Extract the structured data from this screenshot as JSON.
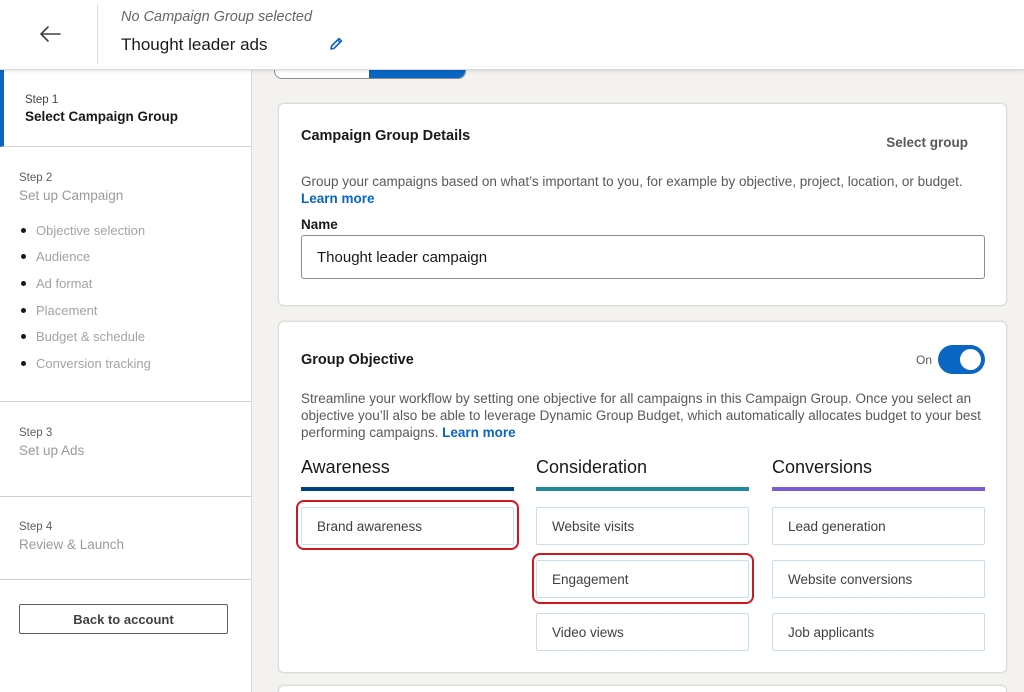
{
  "header": {
    "subtitle": "No Campaign Group selected",
    "title": "Thought leader ads"
  },
  "sidebar": {
    "step1": {
      "label": "Step 1",
      "title": "Select Campaign Group"
    },
    "step2": {
      "label": "Step 2",
      "title": "Set up Campaign",
      "substeps": [
        "Objective selection",
        "Audience",
        "Ad format",
        "Placement",
        "Budget & schedule",
        "Conversion tracking"
      ]
    },
    "step3": {
      "label": "Step 3",
      "title": "Set up Ads"
    },
    "step4": {
      "label": "Step 4",
      "title": "Review & Launch"
    },
    "back_button": "Back to account"
  },
  "details": {
    "title": "Campaign Group Details",
    "select_group": "Select group",
    "description": "Group your campaigns based on what’s important to you, for example by objective, project, location, or budget.",
    "learn_more": "Learn more",
    "name_label": "Name",
    "name_value": "Thought leader campaign"
  },
  "objective": {
    "title": "Group Objective",
    "toggle_label": "On",
    "toggle_on": true,
    "description": "Streamline your workflow by setting one objective for all campaigns in this Campaign Group. Once you select an objective you’ll also be able to leverage Dynamic Group Budget, which automatically allocates budget to your best performing campaigns.",
    "learn_more": "Learn more",
    "columns": [
      {
        "heading": "Awareness",
        "color": "#004182",
        "options": [
          "Brand awareness"
        ]
      },
      {
        "heading": "Consideration",
        "color": "#1f8a99",
        "options": [
          "Website visits",
          "Engagement",
          "Video views"
        ]
      },
      {
        "heading": "Conversions",
        "color": "#7a5cd6",
        "options": [
          "Lead generation",
          "Website conversions",
          "Job applicants"
        ]
      }
    ]
  },
  "colors": {
    "accent": "#0a66c2",
    "highlight": "#d0161e"
  }
}
